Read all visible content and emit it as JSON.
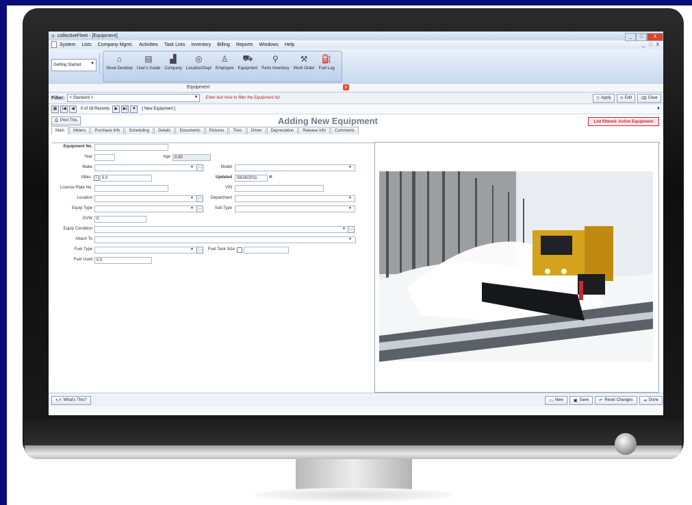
{
  "window": {
    "title": "collectiveFleet - [Equipment]",
    "icon": "fleet-app-icon",
    "controls": [
      "_",
      "□",
      "X"
    ]
  },
  "menu": [
    "System",
    "Lists",
    "Company Mgmt.",
    "Activities",
    "Task Lists",
    "Inventory",
    "Billing",
    "Reports",
    "Windows",
    "Help"
  ],
  "menu_right": [
    "_",
    "□",
    "X"
  ],
  "toolbar": {
    "getting_started": "Getting Started",
    "buttons": [
      {
        "label": "Show Desktop",
        "icon": "house-icon"
      },
      {
        "label": "User's Guide",
        "icon": "book-icon"
      },
      {
        "label": "Company",
        "icon": "building-icon"
      },
      {
        "label": "Location/Dept",
        "icon": "globe-icon"
      },
      {
        "label": "Employee",
        "icon": "person-icon"
      },
      {
        "label": "Equipment",
        "icon": "vehicle-icon"
      },
      {
        "label": "Parts Inventory",
        "icon": "magnifier-icon"
      },
      {
        "label": "Work Order",
        "icon": "wrench-icon"
      },
      {
        "label": "Fuel Log",
        "icon": "fuel-pump-icon"
      }
    ]
  },
  "document_tab": {
    "label": "Equipment",
    "close": "x"
  },
  "filter": {
    "label": "Filter:",
    "selected": "< Standard >",
    "hint": "Enter text here to filter the Equipment list",
    "apply": "Apply",
    "edit": "Edit",
    "clear": "Clear"
  },
  "navigation": {
    "record_count": "0 of 18 Records",
    "current": "[ New Equipment ]"
  },
  "title_row": {
    "print": "Print This",
    "title": "Adding New Equipment",
    "list_filter": "List filtered: Active Equipment"
  },
  "tabs": [
    "Main",
    "Meters",
    "Purchase Info",
    "Scheduling",
    "Details",
    "Documents",
    "Pictures",
    "Tires",
    "Driver",
    "Depreciation",
    "Release Info",
    "Comments"
  ],
  "form": {
    "equipment_no": {
      "label": "Equipment No.",
      "value": ""
    },
    "year": {
      "label": "Year",
      "value": ""
    },
    "age": {
      "label": "Age",
      "value": "0.00"
    },
    "make": {
      "label": "Make",
      "value": ""
    },
    "model": {
      "label": "Model",
      "value": ""
    },
    "miles": {
      "label": "Miles",
      "value": "0.0",
      "checked": true
    },
    "updated": {
      "label": "Updated",
      "value": "08/26/2011"
    },
    "license_plate": {
      "label": "License Plate No.",
      "value": ""
    },
    "vin": {
      "label": "VIN",
      "value": ""
    },
    "location": {
      "label": "Location",
      "value": ""
    },
    "department": {
      "label": "Department",
      "value": ""
    },
    "equip_type": {
      "label": "Equip Type",
      "value": ""
    },
    "sub_type": {
      "label": "Sub Type",
      "value": ""
    },
    "gvw": {
      "label": "GVW",
      "value": "0"
    },
    "equip_condition": {
      "label": "Equip Condition",
      "value": ""
    },
    "attach_to": {
      "label": "Attach To",
      "value": ""
    },
    "fuel_type": {
      "label": "Fuel Type",
      "value": ""
    },
    "fuel_tank_size": {
      "label": "Fuel Tank Size",
      "value": ""
    },
    "fuel_used": {
      "label": "Fuel Used",
      "value": "0.0"
    }
  },
  "status_bar": {
    "whats_this": "What's This?",
    "new": "New",
    "save": "Save",
    "reset": "Reset Changes",
    "done": "Done"
  }
}
